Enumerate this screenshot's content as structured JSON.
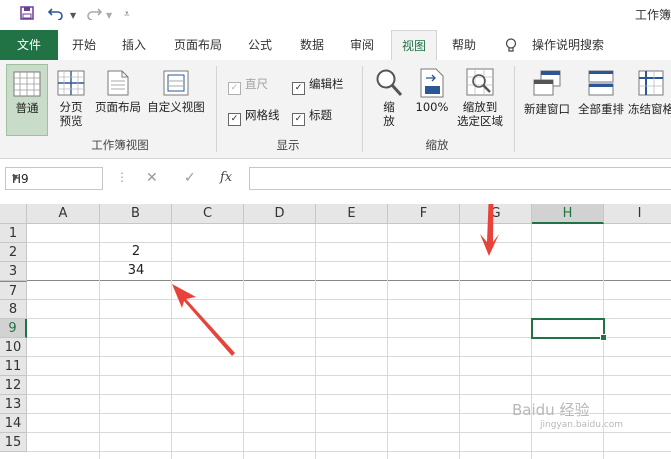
{
  "qat": {
    "title": "工作簿"
  },
  "tabs": [
    "文件",
    "开始",
    "插入",
    "页面布局",
    "公式",
    "数据",
    "审阅",
    "视图",
    "帮助"
  ],
  "search_label": "操作说明搜索",
  "ribbon": {
    "workbook_views": {
      "normal": "普通",
      "page_break_1": "分页",
      "page_break_2": "预览",
      "page_layout": "页面布局",
      "custom": "自定义视图",
      "group": "工作簿视图"
    },
    "show": {
      "ruler": "直尺",
      "formula_bar": "编辑栏",
      "gridlines": "网格线",
      "headings": "标题",
      "group": "显示"
    },
    "zoom": {
      "zoom_1": "缩",
      "zoom_2": "放",
      "hundred": "100%",
      "to_sel_1": "缩放到",
      "to_sel_2": "选定区域",
      "group": "缩放"
    },
    "window": {
      "new_window": "新建窗口",
      "arrange_all": "全部重排",
      "freeze": "冻结窗格"
    }
  },
  "formula_bar": {
    "name_box": "H9",
    "fx": "fx",
    "value": ""
  },
  "columns": [
    "A",
    "B",
    "C",
    "D",
    "E",
    "F",
    "G",
    "H",
    "I"
  ],
  "rows": [
    "1",
    "2",
    "3",
    "7",
    "8",
    "9",
    "10",
    "11",
    "12",
    "13",
    "14",
    "15"
  ],
  "cells": {
    "B2": "2",
    "B3": "34"
  },
  "selected_cell": "H9",
  "watermark": "Baidu 经验",
  "watermark_sub": "jingyan.baidu.com"
}
